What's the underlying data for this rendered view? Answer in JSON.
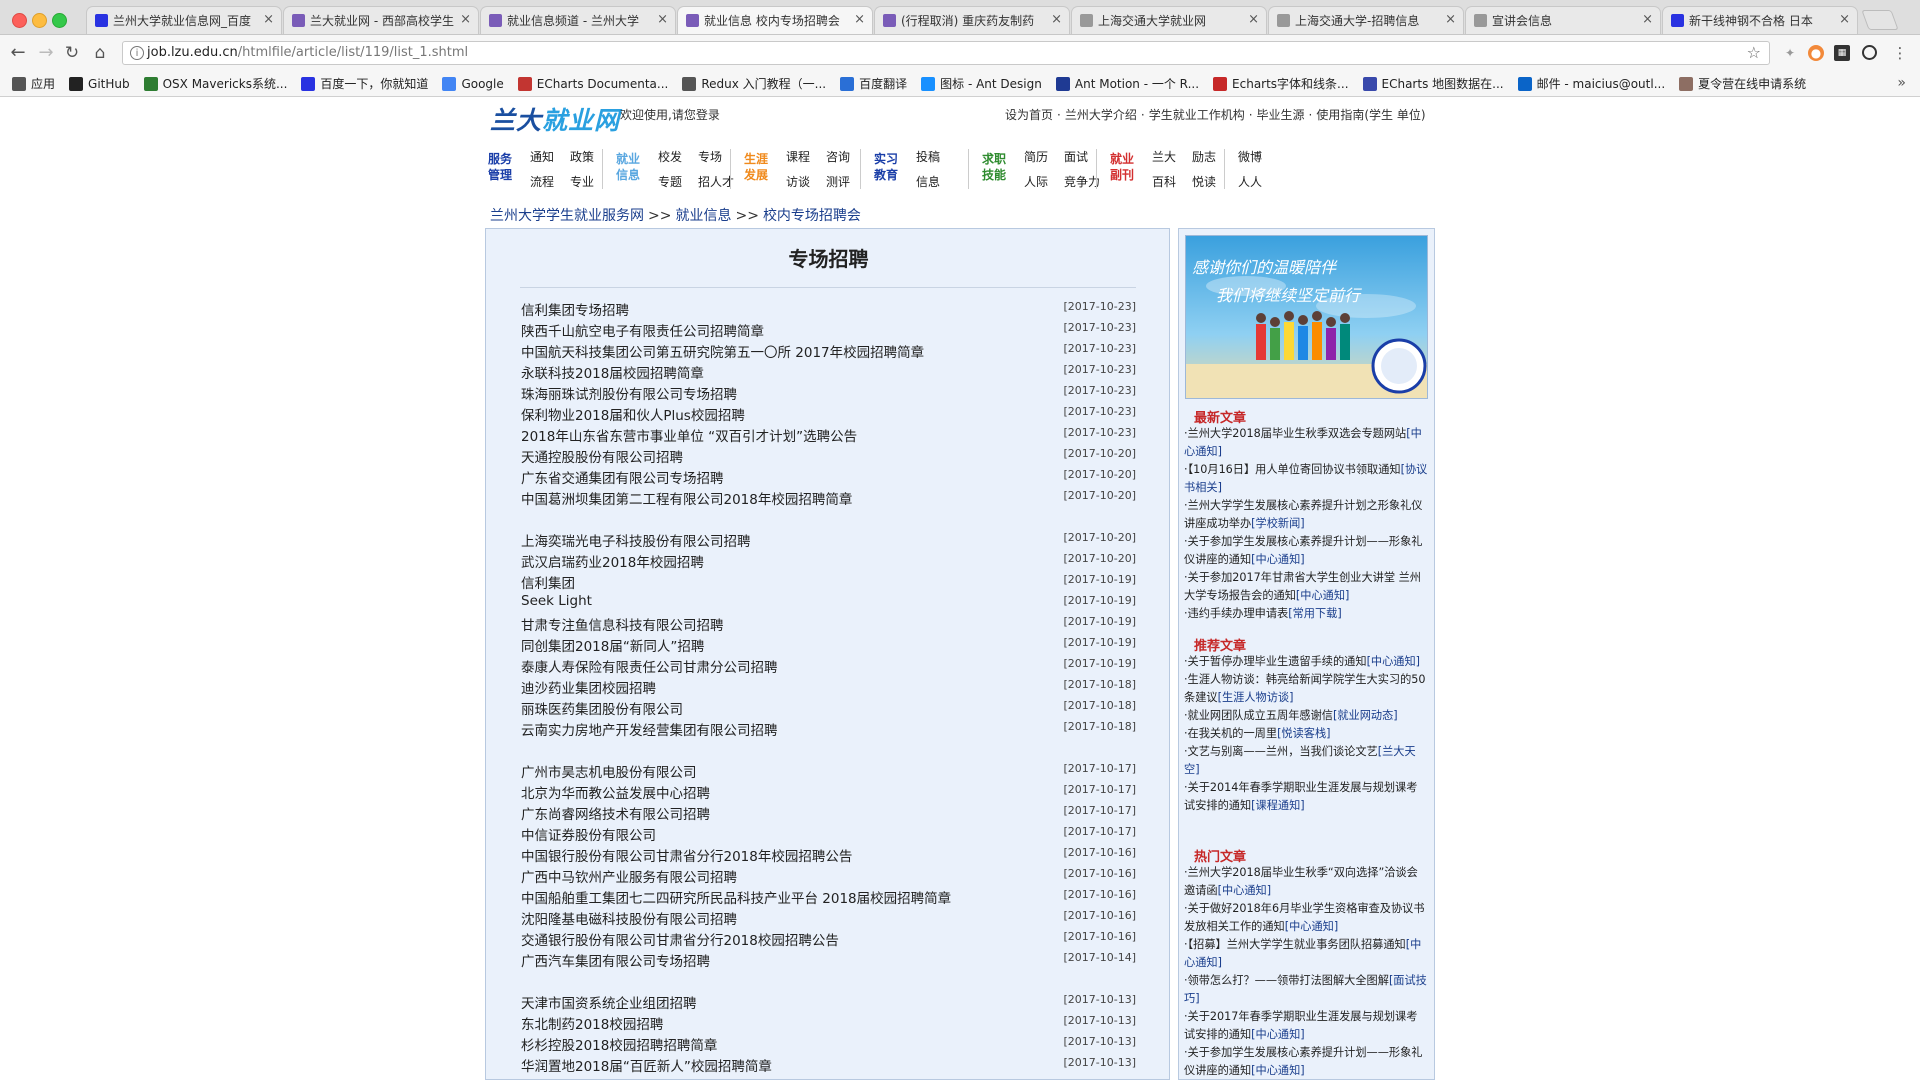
{
  "browser": {
    "tabs": [
      {
        "title": "兰州大学就业信息网_百度",
        "active": false,
        "icon_color": "#2932e1"
      },
      {
        "title": "兰大就业网 - 西部高校学生",
        "active": false,
        "icon_color": "#7a5cb8"
      },
      {
        "title": "就业信息频道 - 兰州大学",
        "active": false,
        "icon_color": "#7a5cb8"
      },
      {
        "title": "就业信息  校内专场招聘会",
        "active": true,
        "icon_color": "#7a5cb8"
      },
      {
        "title": "(行程取消) 重庆药友制药",
        "active": false,
        "icon_color": "#7a5cb8"
      },
      {
        "title": "上海交通大学就业网",
        "active": false,
        "icon_color": "#999999"
      },
      {
        "title": "上海交通大学-招聘信息",
        "active": false,
        "icon_color": "#999999"
      },
      {
        "title": "宣讲会信息",
        "active": false,
        "icon_color": "#999999"
      },
      {
        "title": "新干线神钢不合格 日本",
        "active": false,
        "icon_color": "#2932e1"
      }
    ],
    "url_host": "job.lzu.edu.cn",
    "url_path": "/htmlfile/article/list/119/list_1.shtml"
  },
  "bookmarks": [
    {
      "label": "应用",
      "icon": "apps-grid-icon",
      "color": "#555555"
    },
    {
      "label": "GitHub",
      "icon": "github-icon",
      "color": "#222222"
    },
    {
      "label": "OSX Mavericks系统...",
      "icon": "osx-icon",
      "color": "#2e7d32"
    },
    {
      "label": "百度一下，你就知道",
      "icon": "baidu-icon",
      "color": "#2932e1"
    },
    {
      "label": "Google",
      "icon": "google-icon",
      "color": "#4285f4"
    },
    {
      "label": "ECharts Documenta...",
      "icon": "echarts-icon",
      "color": "#c23531"
    },
    {
      "label": "Redux 入门教程（一...",
      "icon": "redux-icon",
      "color": "#555555"
    },
    {
      "label": "百度翻译",
      "icon": "translate-icon",
      "color": "#2a6fd6"
    },
    {
      "label": "图标 - Ant Design",
      "icon": "antd-icon",
      "color": "#1890ff"
    },
    {
      "label": "Ant Motion - 一个 R...",
      "icon": "ant-motion-icon",
      "color": "#1f3a93"
    },
    {
      "label": "Echarts字体和线条...",
      "icon": "csdn-icon",
      "color": "#c62828"
    },
    {
      "label": "ECharts 地图数据在...",
      "icon": "echarts-doc-icon",
      "color": "#3949ab"
    },
    {
      "label": "邮件 - maicius@outl...",
      "icon": "outlook-icon",
      "color": "#0a64c8"
    },
    {
      "label": "夏令营在线申请系统",
      "icon": "camp-icon",
      "color": "#8d6e63"
    }
  ],
  "site": {
    "logo_a": "兰大",
    "logo_b": "就业网",
    "welcome": "欢迎使用,请您登录",
    "top_links": [
      "设为首页",
      "兰州大学介绍",
      "学生就业工作机构",
      "毕业生源",
      "使用指南(学生 单位)"
    ],
    "nav": [
      {
        "name": "服务管理",
        "color": "#1a3ea8",
        "items": [
          [
            "通知",
            "政策"
          ],
          [
            "流程",
            "专业"
          ]
        ]
      },
      {
        "name": "就业信息",
        "color": "#5aa7e0",
        "items": [
          [
            "校发",
            "专场"
          ],
          [
            "专题",
            "招人才"
          ]
        ]
      },
      {
        "name": "生涯发展",
        "color": "#f08a1c",
        "items": [
          [
            "课程",
            "咨询"
          ],
          [
            "访谈",
            "测评"
          ]
        ]
      },
      {
        "name": "实习教育",
        "color": "#1a3ea8",
        "items": [
          [
            "投稿"
          ],
          [
            "信息"
          ]
        ]
      },
      {
        "name": "求职技能",
        "color": "#2e8b2e",
        "items": [
          [
            "简历",
            "面试"
          ],
          [
            "人际",
            "竞争力"
          ]
        ]
      },
      {
        "name": "就业副刊",
        "color": "#d32f2f",
        "items": [
          [
            "兰大",
            "励志"
          ],
          [
            "百科",
            "悦读"
          ]
        ]
      },
      {
        "name": "",
        "color": "#222222",
        "items": [
          [
            "微博"
          ],
          [
            "人人"
          ]
        ]
      }
    ],
    "breadcrumb": [
      "兰州大学学生就业服务网",
      "就业信息",
      "校内专场招聘会"
    ],
    "breadcrumb_sep": ">>"
  },
  "main": {
    "title": "专场招聘",
    "articles": [
      {
        "title": "信利集团专场招聘",
        "date": "[2017-10-23]"
      },
      {
        "title": "陕西千山航空电子有限责任公司招聘简章",
        "date": "[2017-10-23]"
      },
      {
        "title": "中国航天科技集团公司第五研究院第五一〇所 2017年校园招聘简章",
        "date": "[2017-10-23]"
      },
      {
        "title": "永联科技2018届校园招聘简章",
        "date": "[2017-10-23]"
      },
      {
        "title": "珠海丽珠试剂股份有限公司专场招聘",
        "date": "[2017-10-23]"
      },
      {
        "title": "保利物业2018届和伙人Plus校园招聘",
        "date": "[2017-10-23]"
      },
      {
        "title": "2018年山东省东营市事业单位 “双百引才计划”选聘公告",
        "date": "[2017-10-23]"
      },
      {
        "title": "天通控股股份有限公司招聘",
        "date": "[2017-10-20]"
      },
      {
        "title": "广东省交通集团有限公司专场招聘",
        "date": "[2017-10-20]"
      },
      {
        "title": "中国葛洲坝集团第二工程有限公司2018年校园招聘简章",
        "date": "[2017-10-20]"
      },
      {
        "title": "上海奕瑞光电子科技股份有限公司招聘",
        "date": "[2017-10-20]"
      },
      {
        "title": "武汉启瑞药业2018年校园招聘",
        "date": "[2017-10-20]"
      },
      {
        "title": "信利集团",
        "date": "[2017-10-19]"
      },
      {
        "title": "Seek Light",
        "date": "[2017-10-19]"
      },
      {
        "title": "甘肃专注鱼信息科技有限公司招聘",
        "date": "[2017-10-19]"
      },
      {
        "title": "同创集团2018届“新同人”招聘",
        "date": "[2017-10-19]"
      },
      {
        "title": "泰康人寿保险有限责任公司甘肃分公司招聘",
        "date": "[2017-10-19]"
      },
      {
        "title": "迪沙药业集团校园招聘",
        "date": "[2017-10-18]"
      },
      {
        "title": "丽珠医药集团股份有限公司",
        "date": "[2017-10-18]"
      },
      {
        "title": "云南实力房地产开发经营集团有限公司招聘",
        "date": "[2017-10-18]"
      },
      {
        "title": "广州市昊志机电股份有限公司",
        "date": "[2017-10-17]"
      },
      {
        "title": "北京为华而教公益发展中心招聘",
        "date": "[2017-10-17]"
      },
      {
        "title": "广东尚睿网络技术有限公司招聘",
        "date": "[2017-10-17]"
      },
      {
        "title": "中信证券股份有限公司",
        "date": "[2017-10-17]"
      },
      {
        "title": "中国银行股份有限公司甘肃省分行2018年校园招聘公告",
        "date": "[2017-10-16]"
      },
      {
        "title": "广西中马钦州产业服务有限公司招聘",
        "date": "[2017-10-16]"
      },
      {
        "title": "中国船舶重工集团七二四研究所民品科技产业平台 2018届校园招聘简章",
        "date": "[2017-10-16]"
      },
      {
        "title": "沈阳隆基电磁科技股份有限公司招聘",
        "date": "[2017-10-16]"
      },
      {
        "title": "交通银行股份有限公司甘肃省分行2018校园招聘公告",
        "date": "[2017-10-16]"
      },
      {
        "title": "广西汽车集团有限公司专场招聘",
        "date": "[2017-10-14]"
      },
      {
        "title": "天津市国资系统企业组团招聘",
        "date": "[2017-10-13]"
      },
      {
        "title": "东北制药2018校园招聘",
        "date": "[2017-10-13]"
      },
      {
        "title": "杉杉控股2018校园招聘招聘简章",
        "date": "[2017-10-13]"
      },
      {
        "title": "华润置地2018届“百匠新人”校园招聘简章",
        "date": "[2017-10-13]"
      }
    ]
  },
  "sidebar": {
    "banner_line1": "感谢你们的温暖陪伴",
    "banner_line2": "我们将继续坚定前行",
    "latest_title": "最新文章",
    "latest": [
      {
        "text": "·兰州大学2018届毕业生秋季双选会专题网站",
        "tag": "[中心通知]"
      },
      {
        "text": "·【10月16日】用人单位寄回协议书领取通知",
        "tag": "[协议书相关]"
      },
      {
        "text": "·兰州大学学生发展核心素养提升计划之形象礼仪讲座成功举办",
        "tag": "[学校新闻]"
      },
      {
        "text": "·关于参加学生发展核心素养提升计划——形象礼仪讲座的通知",
        "tag": "[中心通知]"
      },
      {
        "text": "·关于参加2017年甘肃省大学生创业大讲堂 兰州大学专场报告会的通知",
        "tag": "[中心通知]"
      },
      {
        "text": "·违约手续办理申请表",
        "tag": "[常用下载]"
      }
    ],
    "recommend_title": "推荐文章",
    "recommend": [
      {
        "text": "·关于暂停办理毕业生遗留手续的通知",
        "tag": "[中心通知]"
      },
      {
        "text": "·生涯人物访谈：韩亮给新闻学院学生大实习的50条建议",
        "tag": "[生涯人物访谈]"
      },
      {
        "text": "·就业网团队成立五周年感谢信",
        "tag": "[就业网动态]"
      },
      {
        "text": "·在我关机的一周里",
        "tag": "[悦读客栈]"
      },
      {
        "text": "·文艺与别离——兰州，当我们谈论文艺",
        "tag": "[兰大天空]"
      },
      {
        "text": "·关于2014年春季学期职业生涯发展与规划课考试安排的通知",
        "tag": "[课程通知]"
      }
    ],
    "hot_title": "热门文章",
    "hot": [
      {
        "text": "·兰州大学2018届毕业生秋季“双向选择”洽谈会邀请函",
        "tag": "[中心通知]"
      },
      {
        "text": "·关于做好2018年6月毕业学生资格审查及协议书发放相关工作的通知",
        "tag": "[中心通知]"
      },
      {
        "text": "·【招募】兰州大学学生就业事务团队招募通知",
        "tag": "[中心通知]"
      },
      {
        "text": "·领带怎么打？——领带打法图解大全图解",
        "tag": "[面试技巧]"
      },
      {
        "text": "·关于2017年春季学期职业生涯发展与规划课考试安排的通知",
        "tag": "[中心通知]"
      },
      {
        "text": "·关于参加学生发展核心素养提升计划——形象礼仪讲座的通知",
        "tag": "[中心通知]"
      }
    ]
  }
}
